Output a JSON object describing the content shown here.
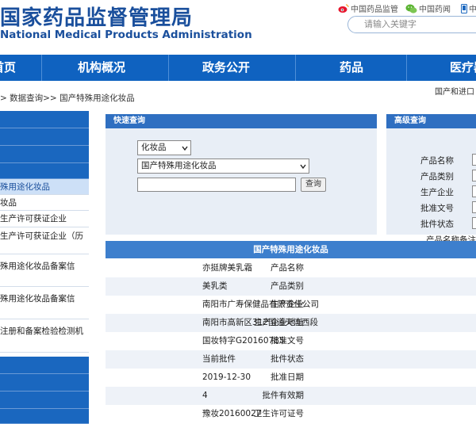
{
  "header": {
    "logo_cn": "国家药品监督管理局",
    "logo_en": "National Medical Products Administration",
    "links": [
      {
        "label": "中国药品监管",
        "icon": "weibo-icon",
        "color": "#e6162d"
      },
      {
        "label": "中国药闻",
        "icon": "wechat-icon",
        "color": "#5bb432"
      },
      {
        "label": "中",
        "icon": "mobile-icon",
        "color": "#1a67bf"
      }
    ],
    "search_placeholder": "请输入关键字"
  },
  "nav": {
    "items": [
      "首页",
      "机构概况",
      "政务公开",
      "药品",
      "医疗器械"
    ]
  },
  "breadcrumb": "> 数据查询>> 国产特殊用途化妆品",
  "top_right_note": "国产和进口",
  "sidebar": {
    "items": [
      {
        "label": "",
        "style": "blue"
      },
      {
        "label": "",
        "style": "blue"
      },
      {
        "label": "",
        "style": "blue"
      },
      {
        "label": "",
        "style": "blue"
      },
      {
        "label": "殊用途化妆品",
        "style": "active"
      },
      {
        "label": "妆品",
        "style": "white"
      },
      {
        "label": "生产许可获证企业",
        "style": "white"
      },
      {
        "label": "生产许可获证企业（历",
        "style": "white"
      },
      {
        "label": "殊用途化妆品备案信",
        "style": "white"
      },
      {
        "label": "殊用途化妆品备案信",
        "style": "white"
      },
      {
        "label": "注册和备案检验检测机",
        "style": "white"
      },
      {
        "label": "",
        "style": "blue"
      },
      {
        "label": "",
        "style": "blue"
      },
      {
        "label": "",
        "style": "blue"
      },
      {
        "label": "",
        "style": "blue"
      }
    ]
  },
  "quick_search": {
    "title": "快速查询",
    "category_value": "化妆品",
    "database_value": "国产特殊用途化妆品",
    "keyword_value": "",
    "search_button": "查询"
  },
  "advanced_search": {
    "title": "高级查询",
    "fields": [
      "产品名称",
      "产品类别",
      "生产企业",
      "批准文号",
      "批件状态",
      "产品名称备注"
    ]
  },
  "detail": {
    "title": "国产特殊用途化妆品",
    "rows": [
      {
        "label": "产品名称",
        "value": "亦挺牌美乳霜"
      },
      {
        "label": "产品类别",
        "value": "美乳类"
      },
      {
        "label": "生产企业",
        "value": "南阳市广寿保健品有限责任公司"
      },
      {
        "label": "生产企业地址",
        "value": "南阳市高新区312国道天洼西段"
      },
      {
        "label": "批准文号",
        "value": "国妆特字G20160785"
      },
      {
        "label": "批件状态",
        "value": "当前批件"
      },
      {
        "label": "批准日期",
        "value": "2019-12-30"
      },
      {
        "label": "批件有效期",
        "value": "4"
      },
      {
        "label": "卫生许可证号",
        "value": "豫妆20160027"
      }
    ]
  }
}
